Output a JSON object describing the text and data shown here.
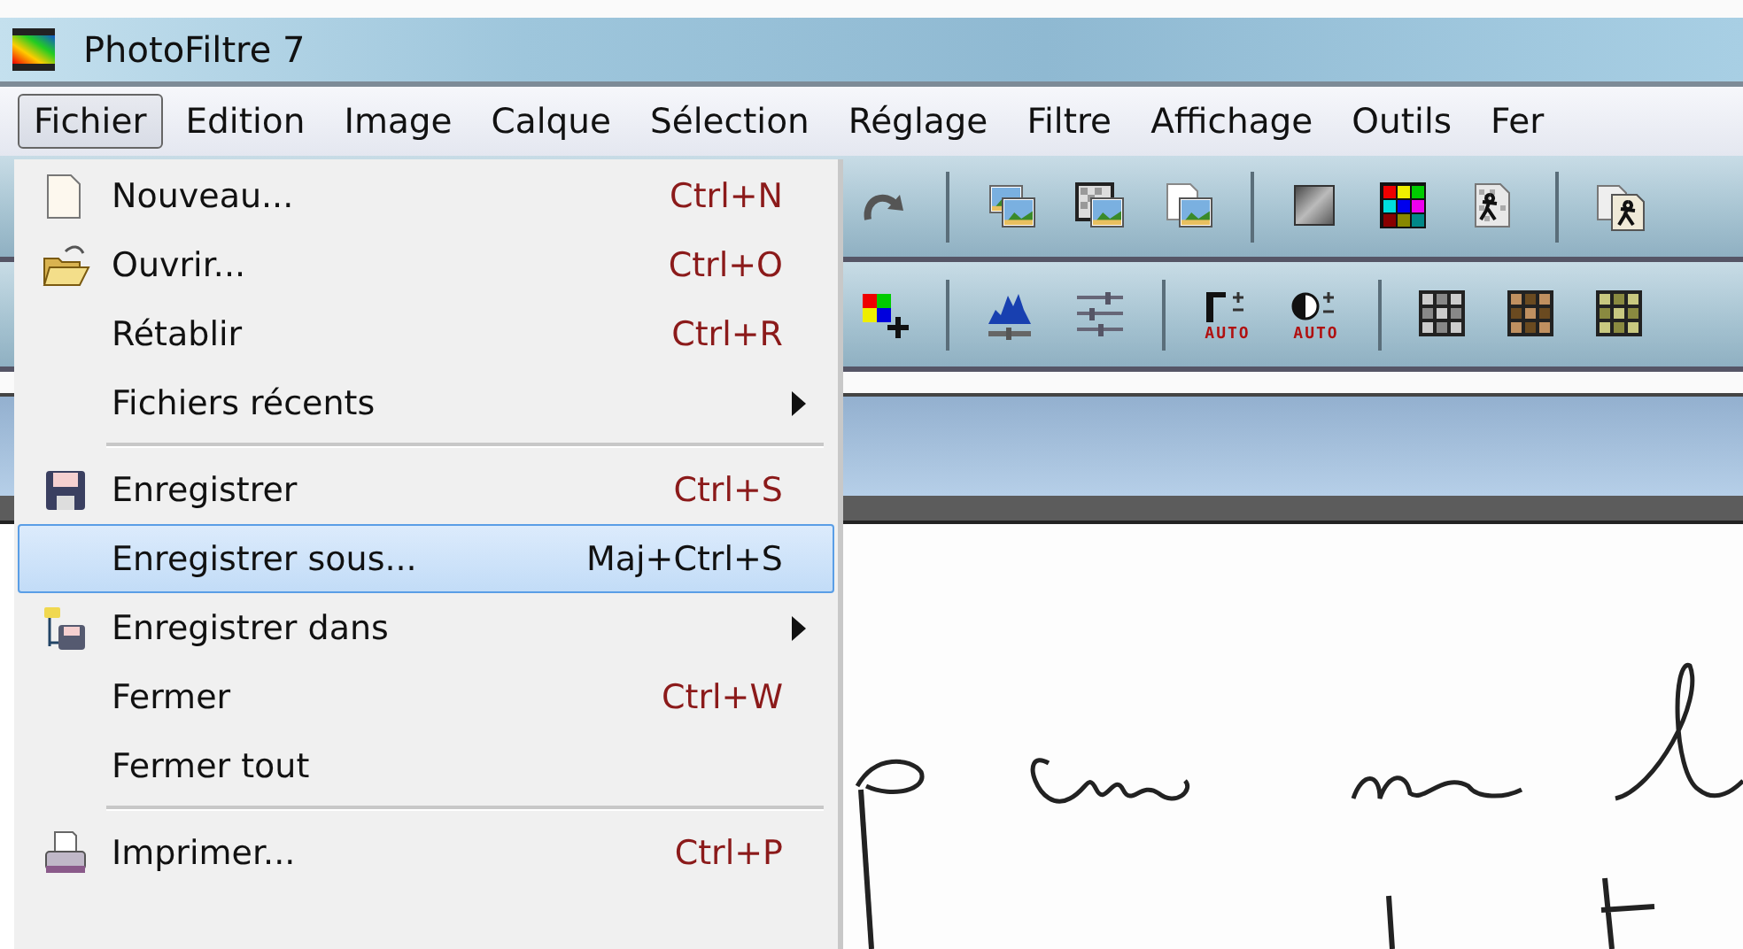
{
  "window": {
    "title": "PhotoFiltre 7"
  },
  "menubar": [
    {
      "label": "Fichier",
      "selected": true
    },
    {
      "label": "Edition",
      "selected": false
    },
    {
      "label": "Image",
      "selected": false
    },
    {
      "label": "Calque",
      "selected": false
    },
    {
      "label": "Sélection",
      "selected": false
    },
    {
      "label": "Réglage",
      "selected": false
    },
    {
      "label": "Filtre",
      "selected": false
    },
    {
      "label": "Affichage",
      "selected": false
    },
    {
      "label": "Outils",
      "selected": false
    },
    {
      "label": "Fer",
      "selected": false
    }
  ],
  "toolbar_1": [
    {
      "kind": "redo"
    },
    {
      "kind": "sep"
    },
    {
      "kind": "images"
    },
    {
      "kind": "checker-image"
    },
    {
      "kind": "page-image"
    },
    {
      "kind": "sep"
    },
    {
      "kind": "gray-square"
    },
    {
      "kind": "color-grid"
    },
    {
      "kind": "checker-figure"
    },
    {
      "kind": "sep"
    },
    {
      "kind": "figure-pages"
    }
  ],
  "toolbar_2": [
    {
      "kind": "color-plus"
    },
    {
      "kind": "sep"
    },
    {
      "kind": "histogram"
    },
    {
      "kind": "sliders"
    },
    {
      "kind": "sep"
    },
    {
      "kind": "gamma",
      "caption": "AUTO"
    },
    {
      "kind": "contrast",
      "caption": "AUTO"
    },
    {
      "kind": "sep"
    },
    {
      "kind": "grid-gray"
    },
    {
      "kind": "grid-brown"
    },
    {
      "kind": "grid-olive"
    }
  ],
  "menu": {
    "items": [
      {
        "kind": "page",
        "label": "Nouveau...",
        "shortcut": "Ctrl+N",
        "submenu": false,
        "selected": false
      },
      {
        "kind": "folder",
        "label": "Ouvrir...",
        "shortcut": "Ctrl+O",
        "submenu": false,
        "selected": false
      },
      {
        "kind": "plain",
        "label": "Rétablir",
        "shortcut": "Ctrl+R",
        "submenu": false,
        "selected": false
      },
      {
        "kind": "plain",
        "label": "Fichiers récents",
        "submenu": true,
        "selected": false
      },
      {
        "kind": "separator"
      },
      {
        "kind": "floppy",
        "label": "Enregistrer",
        "shortcut": "Ctrl+S",
        "submenu": false,
        "selected": false
      },
      {
        "kind": "plain",
        "label": "Enregistrer sous...",
        "shortcut": "Maj+Ctrl+S",
        "submenu": false,
        "selected": true
      },
      {
        "kind": "folder-floppy",
        "label": "Enregistrer dans",
        "submenu": true,
        "selected": false
      },
      {
        "kind": "plain",
        "label": "Fermer",
        "shortcut": "Ctrl+W",
        "submenu": false,
        "selected": false
      },
      {
        "kind": "plain",
        "label": "Fermer tout",
        "submenu": false,
        "selected": false
      },
      {
        "kind": "separator"
      },
      {
        "kind": "printer",
        "label": "Imprimer...",
        "shortcut": "Ctrl+P",
        "submenu": false,
        "selected": false
      }
    ]
  }
}
